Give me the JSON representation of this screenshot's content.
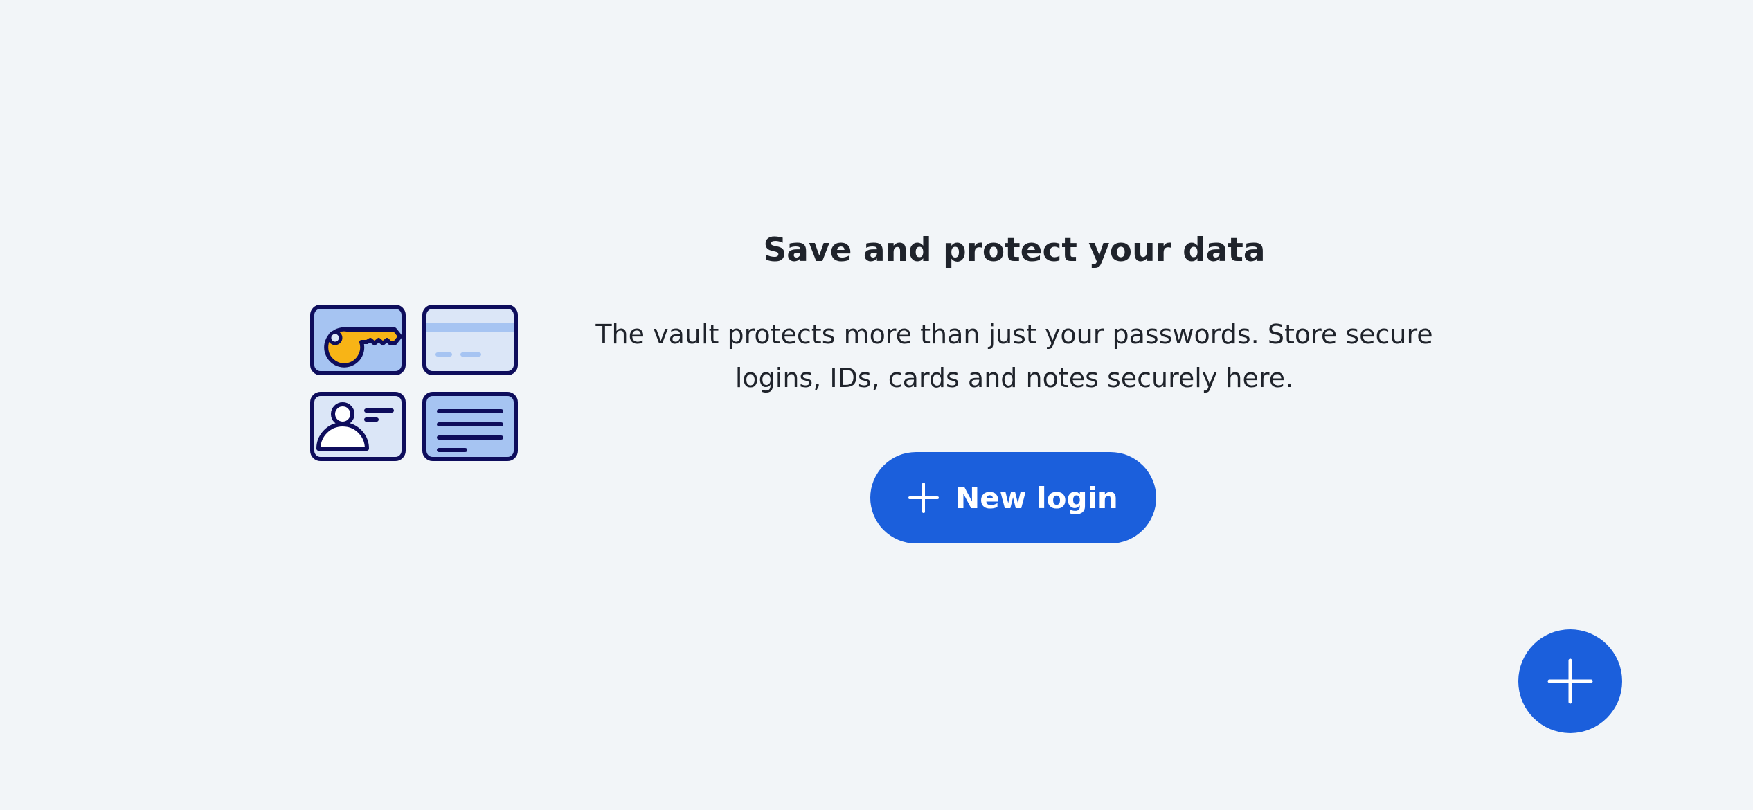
{
  "empty_state": {
    "title": "Save and protect your data",
    "description": "The vault protects more than just your passwords. Store secure logins, IDs, cards and notes securely here.",
    "illustration_icons": [
      "key-icon",
      "card-icon",
      "identity-icon",
      "note-icon"
    ]
  },
  "actions": {
    "new_login_label": "New login",
    "new_login_icon": "plus-icon",
    "fab_icon": "plus-icon"
  },
  "colors": {
    "background": "#f2f5f8",
    "accent": "#1b5fdc",
    "text": "#1f232b",
    "illustration_outline": "#0e0d5c",
    "illustration_fill_dark": "#a6c4f2",
    "illustration_fill_light": "#dbe6f7",
    "key": "#f8b416"
  }
}
